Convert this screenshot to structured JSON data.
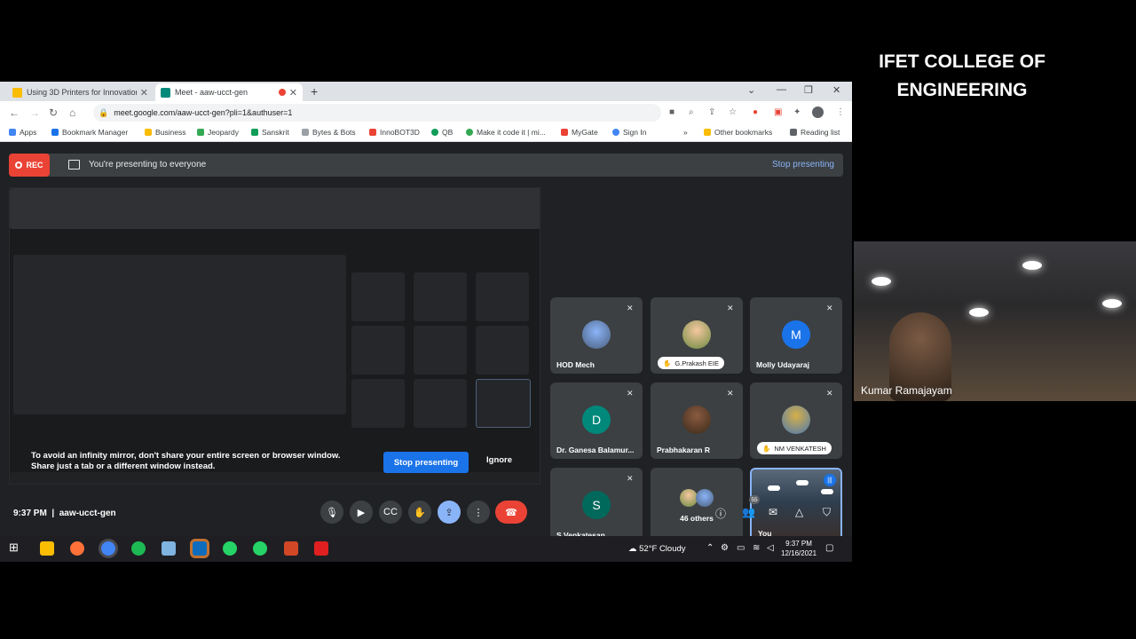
{
  "browser": {
    "tabs": [
      {
        "label": "Using 3D Printers for Innovation",
        "favicon_color": "#fbbc04"
      },
      {
        "label": "Meet - aaw-ucct-gen",
        "favicon_color": "#00897b"
      }
    ],
    "url": "meet.google.com/aaw-ucct-gen?pli=1&authuser=1",
    "bookmarks": [
      {
        "label": "Apps",
        "color": "#4285f4"
      },
      {
        "label": "Bookmark Manager",
        "color": "#1a73e8"
      },
      {
        "label": "Business",
        "color": "#fbbc04"
      },
      {
        "label": "Jeopardy",
        "color": "#34a853"
      },
      {
        "label": "Sanskrit",
        "color": "#0f9d58"
      },
      {
        "label": "Bytes & Bots",
        "color": "#9aa0a6"
      },
      {
        "label": "InnoBOT3D",
        "color": "#ea4335"
      },
      {
        "label": "QB",
        "color": "#0f9d58"
      },
      {
        "label": "Make it code it | mi...",
        "color": "#34a853"
      },
      {
        "label": "MyGate",
        "color": "#ea4335"
      },
      {
        "label": "Sign In",
        "color": "#4285f4"
      },
      {
        "label": "Other bookmarks",
        "color": "#fbbc04"
      },
      {
        "label": "Reading list",
        "color": "#5f6368"
      }
    ]
  },
  "meet": {
    "rec_label": "REC",
    "presenting_text": "You're presenting to everyone",
    "stop_presenting_link": "Stop presenting",
    "infinity_warning": "To avoid an infinity mirror, don't share your entire screen or browser window. Share just a tab or a different window instead.",
    "stop_presenting_button": "Stop presenting",
    "ignore_button": "Ignore",
    "participants": [
      {
        "name": "HOD Mech",
        "avatar": "photo",
        "muted": true
      },
      {
        "name": "G.Prakash EIE",
        "avatar": "photo",
        "muted": true,
        "hand_raised": true
      },
      {
        "name": "Molly Udayaraj",
        "avatar": "M",
        "avatar_color": "#1a73e8",
        "muted": true
      },
      {
        "name": "Dr. Ganesa Balamur...",
        "avatar": "D",
        "avatar_color": "#00897b",
        "muted": true
      },
      {
        "name": "Prabhakaran R",
        "avatar": "photo",
        "muted": true
      },
      {
        "name": "NM VENKATESH",
        "avatar": "photo",
        "muted": true,
        "hand_raised": true
      },
      {
        "name": "S.Venkatesan",
        "avatar": "S",
        "avatar_color": "#00695c",
        "muted": true
      },
      {
        "name": "46 others",
        "avatar": "group"
      },
      {
        "name": "You",
        "avatar": "video",
        "speaking": true
      }
    ],
    "time": "9:37 PM",
    "meeting_code": "aaw-ucct-gen",
    "participant_count": "55"
  },
  "taskbar": {
    "weather": "52°F  Cloudy",
    "clock_time": "9:37 PM",
    "clock_date": "12/16/2021"
  },
  "overlay": {
    "college_name": "IFET COLLEGE OF ENGINEERING",
    "webcam_name": "Kumar Ramajayam"
  }
}
